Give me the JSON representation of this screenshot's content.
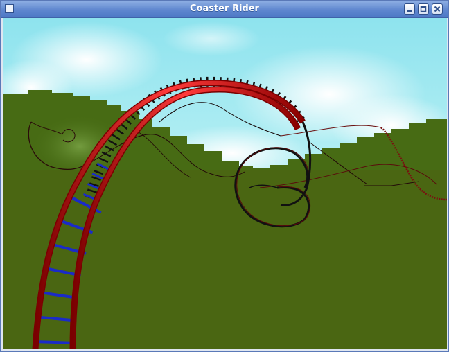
{
  "window": {
    "title": "Coaster Rider"
  },
  "titlebar_buttons": [
    "minimize",
    "maximize",
    "close"
  ],
  "scene": {
    "description_icons": [
      "sky",
      "clouds",
      "hills",
      "ground",
      "coaster-track"
    ],
    "colors": {
      "sky": "#8fe3ec",
      "cloud": "#ffffff",
      "hill": "#476b14",
      "ground": "#4a6612",
      "rail": "#d01010",
      "tie_near": "#1020c0",
      "tie_far": "#111111"
    }
  }
}
